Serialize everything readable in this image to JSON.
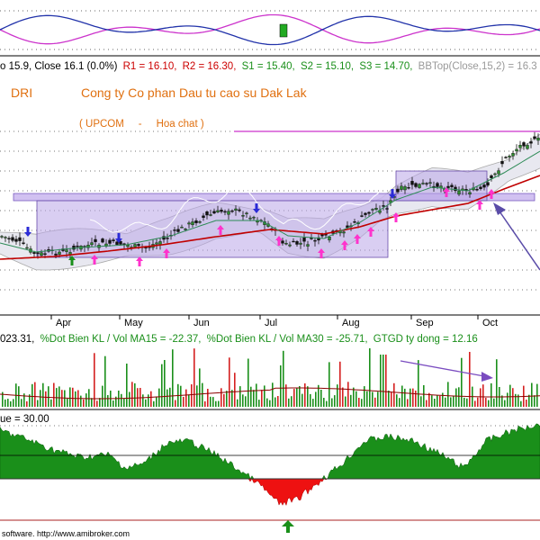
{
  "header": {
    "stats_prefix": "o 15.9, Close 16.1 (0.0%)",
    "r1": "R1 = 16.10,",
    "r2": "R2 = 16.30,",
    "s1": "S1 = 15.40,",
    "s2": "S2 = 15.10,",
    "s3": "S3 = 14.70,",
    "bb": "BBTop(Close,15,2) = 16.3"
  },
  "stock": {
    "ticker": "DRI",
    "company": "Cong ty Co phan Dau tu cao su Dak Lak",
    "exchange_line": "( UPCOM     -     Hoa chat )"
  },
  "volume_header": {
    "v1": "023.31,",
    "v2": "%Dot Bien KL / Vol MA15 = -22.37,",
    "v3": "%Dot Bien KL / Vol MA30 = -25.71,",
    "v4": "GTGD ty dong = 12.16"
  },
  "oscillator_header": {
    "label": "ue = 30.00"
  },
  "footer": {
    "text": "software. http://www.amibroker.com"
  },
  "colors": {
    "price_ma": "#c00000",
    "ma_fast": "#2e8b57",
    "volume_bar": "#1a8f1a",
    "volume_bar_red": "#d42020",
    "volume_ma": "#8b0000",
    "osc_pos": "#1a8f1a",
    "osc_neg": "#ee1111",
    "box": "#b9a6e8",
    "arrow_up": "#ff33cc",
    "arrow_down": "#2b2bd6",
    "arrow_green": "#1a8f1a",
    "trend_arrow": "#5a4ca8"
  },
  "chart_data": [
    {
      "type": "line",
      "title": "DRI",
      "categories": [
        "Apr",
        "May",
        "Jun",
        "Jul",
        "Aug",
        "Sep",
        "Oct"
      ],
      "series": [],
      "annotations": {
        "r1": 16.1,
        "r2": 16.3,
        "s1": 15.4,
        "s2": 15.1,
        "s3": 14.7,
        "bb_top": 16.3,
        "open": 15.9,
        "close": 16.1,
        "change_pct": 0.0
      }
    },
    {
      "type": "bar",
      "title": "",
      "categories": [
        "Apr",
        "May",
        "Jun",
        "Jul",
        "Aug",
        "Sep",
        "Oct"
      ],
      "annotations": {
        "ma15_pct": -22.37,
        "ma30_pct": -25.71,
        "gtgd_ty_dong": 12.16
      }
    },
    {
      "type": "area",
      "title": "",
      "annotations": {
        "value": 30.0
      }
    }
  ]
}
